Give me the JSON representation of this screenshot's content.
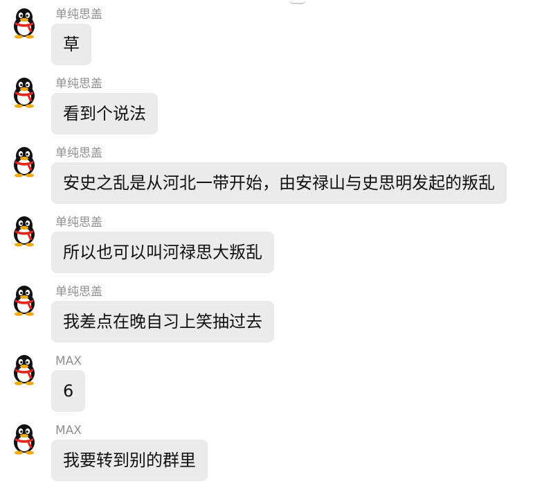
{
  "messages": [
    {
      "sender": "单纯思盖",
      "text": "草"
    },
    {
      "sender": "单纯思盖",
      "text": "看到个说法"
    },
    {
      "sender": "单纯思盖",
      "text": "安史之乱是从河北一带开始，由安禄山与史思明发起的叛乱"
    },
    {
      "sender": "单纯思盖",
      "text": "所以也可以叫河禄思大叛乱"
    },
    {
      "sender": "单纯思盖",
      "text": "我差点在晚自习上笑抽过去"
    },
    {
      "sender": "MAX",
      "text": "6"
    },
    {
      "sender": "MAX",
      "text": "我要转到别的群里"
    }
  ],
  "colors": {
    "bubble": "#ebebeb",
    "sender_name": "#8f8f8f",
    "avatar_scarf": "#e0251b",
    "avatar_beak": "#f2a90f"
  },
  "icons": {
    "avatar": "qq-penguin-avatar-icon"
  }
}
